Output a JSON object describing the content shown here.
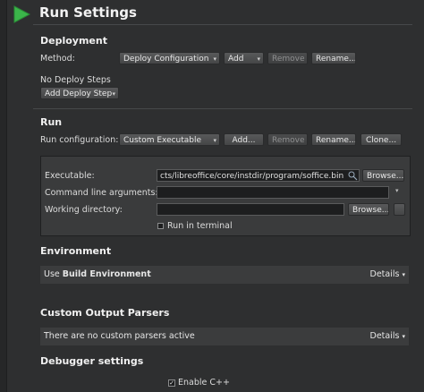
{
  "header": {
    "title": "Run Settings"
  },
  "deployment": {
    "section_title": "Deployment",
    "method_label": "Method:",
    "method_value": "Deploy Configuration",
    "add_label": "Add",
    "remove_label": "Remove",
    "rename_label": "Rename...",
    "no_steps_text": "No Deploy Steps",
    "add_step_label": "Add Deploy Step"
  },
  "run": {
    "section_title": "Run",
    "config_label": "Run configuration:",
    "config_value": "Custom Executable",
    "add_label": "Add...",
    "remove_label": "Remove",
    "rename_label": "Rename...",
    "clone_label": "Clone...",
    "executable_label": "Executable:",
    "executable_value": "cts/libreoffice/core/instdir/program/soffice.bin",
    "browse_label": "Browse...",
    "args_label": "Command line arguments:",
    "args_value": "",
    "workdir_label": "Working directory:",
    "workdir_value": "",
    "workdir_browse_label": "Browse...",
    "run_in_terminal_label": "Run in terminal"
  },
  "environment": {
    "section_title": "Environment",
    "use_prefix": "Use ",
    "env_name": "Build Environment",
    "details_label": "Details"
  },
  "parsers": {
    "section_title": "Custom Output Parsers",
    "status_text": "There are no custom parsers active",
    "details_label": "Details"
  },
  "debugger": {
    "section_title": "Debugger settings",
    "enable_cpp_label": "Enable C++",
    "enable_cpp_checked": true
  },
  "colors": {
    "accent_green": "#3bb54a",
    "background": "#2e2f30"
  }
}
